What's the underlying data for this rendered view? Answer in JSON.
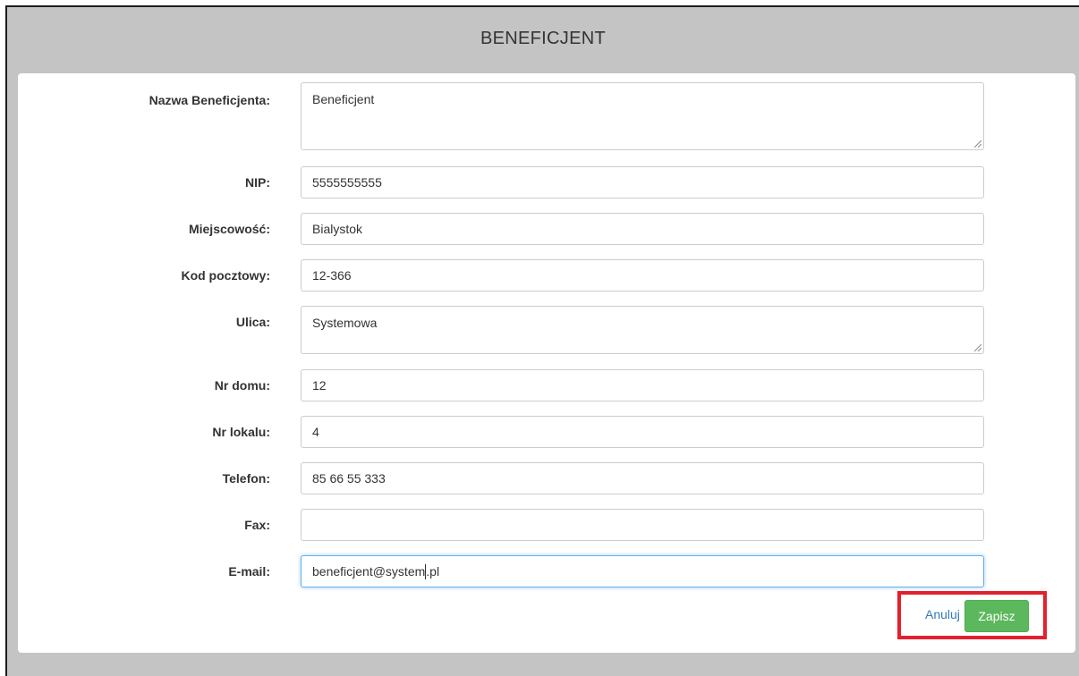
{
  "header": {
    "title": "BENEFICJENT"
  },
  "form": {
    "fields": [
      {
        "label": "Nazwa Beneficjenta:",
        "value": "Beneficjent"
      },
      {
        "label": "NIP:",
        "value": "5555555555"
      },
      {
        "label": "Miejscowość:",
        "value": "Bialystok"
      },
      {
        "label": "Kod pocztowy:",
        "value": "12-366"
      },
      {
        "label": "Ulica:",
        "value": "Systemowa"
      },
      {
        "label": "Nr domu:",
        "value": "12"
      },
      {
        "label": "Nr lokalu:",
        "value": "4"
      },
      {
        "label": "Telefon:",
        "value": "85 66 55 333"
      },
      {
        "label": "Fax:",
        "value": ""
      },
      {
        "label": "E-mail:",
        "value_before_caret": "beneficjent@system",
        "value_after_caret": ".pl"
      }
    ]
  },
  "actions": {
    "cancel_label": "Anuluj",
    "save_label": "Zapisz",
    "highlight_color": "#e3202e",
    "save_color": "#5cb85c",
    "link_color": "#337ab7"
  }
}
